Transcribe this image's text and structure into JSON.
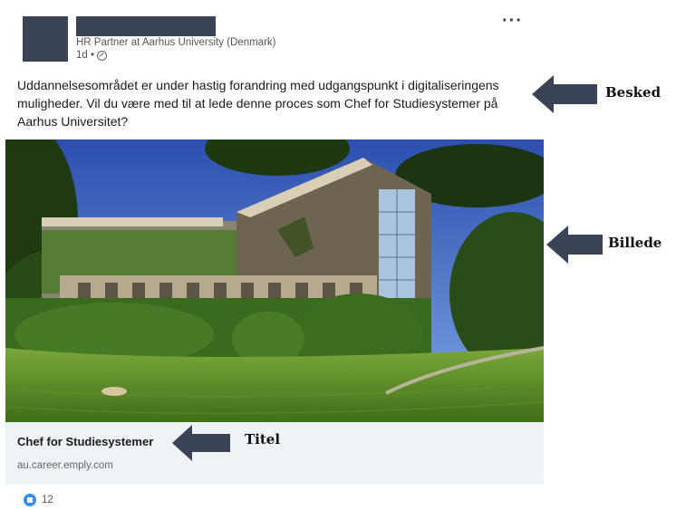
{
  "post": {
    "author_headline": "HR Partner at Aarhus University (Denmark)",
    "timestamp": "1d •",
    "visibility_icon": "globe-icon",
    "menu_icon": "more-options-icon",
    "message": "Uddannelsesområdet er under hastig forandring med udgangspunkt i digitaliseringens muligheder. Vil du være med til at lede denne proces som Chef for Studiesystemer på Aarhus Universitet?",
    "link_card": {
      "title": "Chef for Studiesystemer",
      "domain": "au.career.emply.com"
    },
    "reactions": {
      "icon": "like-icon",
      "count": "12"
    }
  },
  "annotations": {
    "message_label": "Besked",
    "image_label": "Billede",
    "title_label": "Titel"
  },
  "colors": {
    "arrow": "#3a4456",
    "card_background": "#eef3f8",
    "like_blue": "#378fe9"
  }
}
